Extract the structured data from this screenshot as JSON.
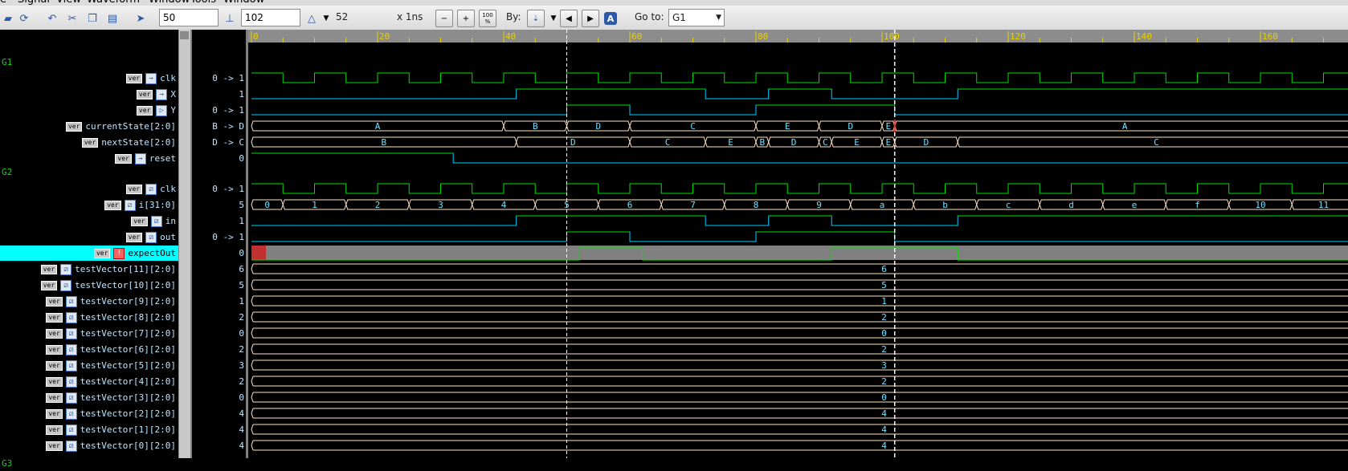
{
  "menu": [
    "e",
    "Signal",
    "View",
    "Waveform",
    "Window",
    "Tools",
    "Window"
  ],
  "toolbar": {
    "cursor_value": "50",
    "marker_value": "102",
    "delta_value": "52",
    "time_unit": "x 1ns",
    "zoom_fit_label": "100 %",
    "by_label": "By:",
    "goto_label": "Go to:",
    "goto_value": "G1",
    "icons": [
      "open-icon",
      "reload-icon",
      "undo-icon",
      "cut-icon",
      "copy-icon",
      "paste-icon",
      "pointer-icon",
      "ruler-icon",
      "delta-icon",
      "zoom-out-icon",
      "zoom-in-icon",
      "zoom-fit-icon",
      "search-by-icon",
      "prev-edge-icon",
      "next-edge-icon",
      "annotate-icon"
    ]
  },
  "ruler": {
    "ticks": [
      "0",
      "20",
      "40",
      "60",
      "80",
      "100",
      "120",
      "140",
      "160"
    ]
  },
  "cursors": {
    "primary_time": 50,
    "secondary_time": 102
  },
  "timeline": {
    "start": 0,
    "end": 175,
    "unit": "ns"
  },
  "groups": [
    "G1",
    "G2",
    "G3"
  ],
  "signals": [
    {
      "name": "clk",
      "badge": "ver",
      "icon": "in",
      "value": "0 -> 1",
      "kind": "clock"
    },
    {
      "name": "X",
      "badge": "ver",
      "icon": "in",
      "value": "1",
      "kind": "bit",
      "edges": [
        [
          0,
          0
        ],
        [
          42,
          1
        ],
        [
          72,
          0
        ],
        [
          82,
          1
        ],
        [
          92,
          0
        ],
        [
          112,
          1
        ]
      ]
    },
    {
      "name": "Y",
      "badge": "ver",
      "icon": "out",
      "value": "0 -> 1",
      "kind": "bit",
      "edges": [
        [
          0,
          0
        ],
        [
          50,
          1
        ],
        [
          60,
          0
        ],
        [
          80,
          1
        ],
        [
          102,
          0
        ]
      ]
    },
    {
      "name": "currentState[2:0]",
      "badge": "ver",
      "icon": "",
      "value": "B -> D",
      "kind": "bus",
      "segments": [
        [
          0,
          40,
          "A"
        ],
        [
          40,
          50,
          "B"
        ],
        [
          50,
          60,
          "D"
        ],
        [
          60,
          80,
          "C"
        ],
        [
          80,
          90,
          "E"
        ],
        [
          90,
          100,
          "D"
        ],
        [
          100,
          102,
          "E"
        ],
        [
          102,
          175,
          "A"
        ]
      ]
    },
    {
      "name": "nextState[2:0]",
      "badge": "ver",
      "icon": "",
      "value": "D -> C",
      "kind": "bus",
      "segments": [
        [
          0,
          42,
          "B"
        ],
        [
          42,
          60,
          "D"
        ],
        [
          60,
          72,
          "C"
        ],
        [
          72,
          80,
          "E"
        ],
        [
          80,
          82,
          "B"
        ],
        [
          82,
          90,
          "D"
        ],
        [
          90,
          92,
          "C"
        ],
        [
          92,
          100,
          "E"
        ],
        [
          100,
          102,
          "E"
        ],
        [
          102,
          112,
          "D"
        ],
        [
          112,
          175,
          "C"
        ]
      ]
    },
    {
      "name": "reset",
      "badge": "ver",
      "icon": "in",
      "value": "0",
      "kind": "bit",
      "edges": [
        [
          0,
          1
        ],
        [
          32,
          0
        ],
        [
          102,
          0
        ]
      ]
    },
    {
      "name": "clk",
      "badge": "ver",
      "icon": "sig",
      "value": "0 -> 1",
      "kind": "clock"
    },
    {
      "name": "i[31:0]",
      "badge": "ver",
      "icon": "sig",
      "value": "5",
      "kind": "bus",
      "segments": [
        [
          0,
          5,
          "0"
        ],
        [
          5,
          15,
          "1"
        ],
        [
          15,
          25,
          "2"
        ],
        [
          25,
          35,
          "3"
        ],
        [
          35,
          45,
          "4"
        ],
        [
          45,
          55,
          "5"
        ],
        [
          55,
          65,
          "6"
        ],
        [
          65,
          75,
          "7"
        ],
        [
          75,
          85,
          "8"
        ],
        [
          85,
          95,
          "9"
        ],
        [
          95,
          105,
          "a"
        ],
        [
          105,
          115,
          "b"
        ],
        [
          115,
          125,
          "c"
        ],
        [
          125,
          135,
          "d"
        ],
        [
          135,
          145,
          "e"
        ],
        [
          145,
          155,
          "f"
        ],
        [
          155,
          165,
          "10"
        ],
        [
          165,
          175,
          "11"
        ]
      ]
    },
    {
      "name": "in",
      "badge": "ver",
      "icon": "sig",
      "value": "1",
      "kind": "bit",
      "edges": [
        [
          0,
          0
        ],
        [
          42,
          1
        ],
        [
          72,
          0
        ],
        [
          82,
          1
        ],
        [
          92,
          0
        ],
        [
          112,
          1
        ]
      ]
    },
    {
      "name": "out",
      "badge": "ver",
      "icon": "sig",
      "value": "0 -> 1",
      "kind": "bit",
      "edges": [
        [
          0,
          0
        ],
        [
          50,
          1
        ],
        [
          60,
          0
        ],
        [
          80,
          1
        ],
        [
          102,
          0
        ]
      ]
    },
    {
      "name": "expectOut",
      "badge": "ver",
      "icon": "err",
      "value": "0",
      "kind": "expect",
      "selected": true
    },
    {
      "name": "testVector[11][2:0]",
      "badge": "ver",
      "icon": "sig",
      "value": "6",
      "kind": "const",
      "label": "6"
    },
    {
      "name": "testVector[10][2:0]",
      "badge": "ver",
      "icon": "sig",
      "value": "5",
      "kind": "const",
      "label": "5"
    },
    {
      "name": "testVector[9][2:0]",
      "badge": "ver",
      "icon": "sig",
      "value": "1",
      "kind": "const",
      "label": "1"
    },
    {
      "name": "testVector[8][2:0]",
      "badge": "ver",
      "icon": "sig",
      "value": "2",
      "kind": "const",
      "label": "2"
    },
    {
      "name": "testVector[7][2:0]",
      "badge": "ver",
      "icon": "sig",
      "value": "0",
      "kind": "const",
      "label": "0"
    },
    {
      "name": "testVector[6][2:0]",
      "badge": "ver",
      "icon": "sig",
      "value": "2",
      "kind": "const",
      "label": "2"
    },
    {
      "name": "testVector[5][2:0]",
      "badge": "ver",
      "icon": "sig",
      "value": "3",
      "kind": "const",
      "label": "3"
    },
    {
      "name": "testVector[4][2:0]",
      "badge": "ver",
      "icon": "sig",
      "value": "2",
      "kind": "const",
      "label": "2"
    },
    {
      "name": "testVector[3][2:0]",
      "badge": "ver",
      "icon": "sig",
      "value": "0",
      "kind": "const",
      "label": "0"
    },
    {
      "name": "testVector[2][2:0]",
      "badge": "ver",
      "icon": "sig",
      "value": "4",
      "kind": "const",
      "label": "4"
    },
    {
      "name": "testVector[1][2:0]",
      "badge": "ver",
      "icon": "sig",
      "value": "4",
      "kind": "const",
      "label": "4"
    },
    {
      "name": "testVector[0][2:0]",
      "badge": "ver",
      "icon": "sig",
      "value": "4",
      "kind": "const",
      "label": "4"
    }
  ],
  "colors": {
    "clock": "#00e000",
    "data": "#00d0ff",
    "bus_text": "#6fe0ff",
    "bus_outline": "#ffe4c4",
    "cursor": "#ffffff",
    "marker_red": "#ff3030",
    "selected": "#00ffff",
    "ruler_text": "#e8d000"
  }
}
